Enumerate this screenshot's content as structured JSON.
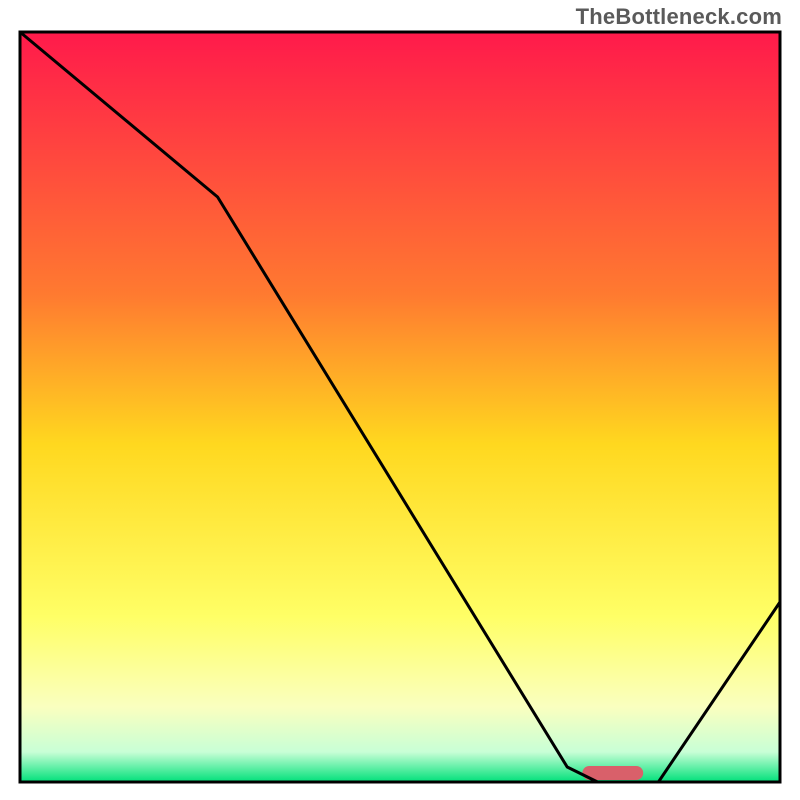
{
  "watermark": "TheBottleneck.com",
  "chart_data": {
    "type": "line",
    "title": "",
    "xlabel": "",
    "ylabel": "",
    "xlim": [
      0,
      100
    ],
    "ylim": [
      0,
      100
    ],
    "grid": false,
    "series": [
      {
        "name": "curve1",
        "x": [
          0,
          26,
          72,
          76,
          84,
          100
        ],
        "values": [
          100,
          78,
          2,
          0,
          0,
          24
        ]
      }
    ],
    "marker": {
      "x_start": 74,
      "x_end": 82,
      "y": 1.2
    },
    "gradient": {
      "stops": [
        {
          "offset": 0.0,
          "color": "#ff1a4b"
        },
        {
          "offset": 0.35,
          "color": "#ff7a30"
        },
        {
          "offset": 0.55,
          "color": "#ffd81f"
        },
        {
          "offset": 0.78,
          "color": "#ffff66"
        },
        {
          "offset": 0.9,
          "color": "#faffbf"
        },
        {
          "offset": 0.96,
          "color": "#c8ffd6"
        },
        {
          "offset": 1.0,
          "color": "#00e07a"
        }
      ]
    },
    "marker_color": "#d9606a",
    "curve_color": "#000000"
  }
}
